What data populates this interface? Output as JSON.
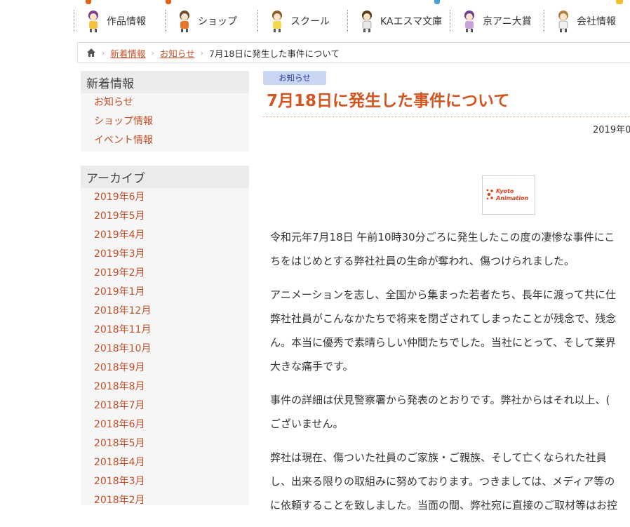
{
  "nav": {
    "items": [
      {
        "label": "作品情報",
        "icon": "character-icon"
      },
      {
        "label": "ショップ",
        "icon": "character-icon"
      },
      {
        "label": "スクール",
        "icon": "character-icon"
      },
      {
        "label": "KAエスマ文庫",
        "icon": "character-icon"
      },
      {
        "label": "京アニ大賞",
        "icon": "character-icon"
      },
      {
        "label": "会社情報",
        "icon": "character-icon"
      }
    ]
  },
  "breadcrumb": {
    "home_icon": "home-icon",
    "items": [
      "新着情報",
      "お知らせ"
    ],
    "current": "7月18日に発生した事件について"
  },
  "sidebar": {
    "news": {
      "title": "新着情報",
      "links": [
        "お知らせ",
        "ショップ情報",
        "イベント情報"
      ]
    },
    "archive": {
      "title": "アーカイブ",
      "links": [
        "2019年6月",
        "2019年5月",
        "2019年4月",
        "2019年3月",
        "2019年2月",
        "2019年1月",
        "2018年12月",
        "2018年11月",
        "2018年10月",
        "2018年9月",
        "2018年8月",
        "2018年7月",
        "2018年6月",
        "2018年5月",
        "2018年4月",
        "2018年3月",
        "2018年2月"
      ]
    }
  },
  "article": {
    "category": "お知らせ",
    "title": "7月18日に発生した事件について",
    "date": "2019年0",
    "logo_text": [
      "Kyoto",
      "Animation"
    ],
    "paragraphs": [
      [
        "令和元年7月18日 午前10時30分ごろに発生したこの度の凄惨な事件にこ",
        "ちをはじめとする弊社社員の生命が奪われ、傷つけられました。"
      ],
      [
        "アニメーションを志し、全国から集まった若者たち、長年に渡って共に仕",
        "弊社社員がこんなかたちで将来を閉ざされてしまったことが残念で、残念",
        "ん。本当に優秀で素晴らしい仲間たちでした。当社にとって、そして業界",
        "大きな痛手です。"
      ],
      [
        "事件の詳細は伏見警察署から発表のとおりです。弊社からはそれ以上、(",
        "ございません。"
      ],
      [
        "弊社は現在、傷ついた社員のご家族・ご親族、そして亡くなられた社員",
        "し、出来る限りの取組みに努めております。つきましては、メディア等の",
        "に依頼することを致しました。当面の間、弊社宛に直接のご取材等はお控"
      ]
    ]
  },
  "colors": {
    "accent": "#d3541e",
    "link": "#c0502a",
    "tag_bg": "#c9d6f2"
  }
}
